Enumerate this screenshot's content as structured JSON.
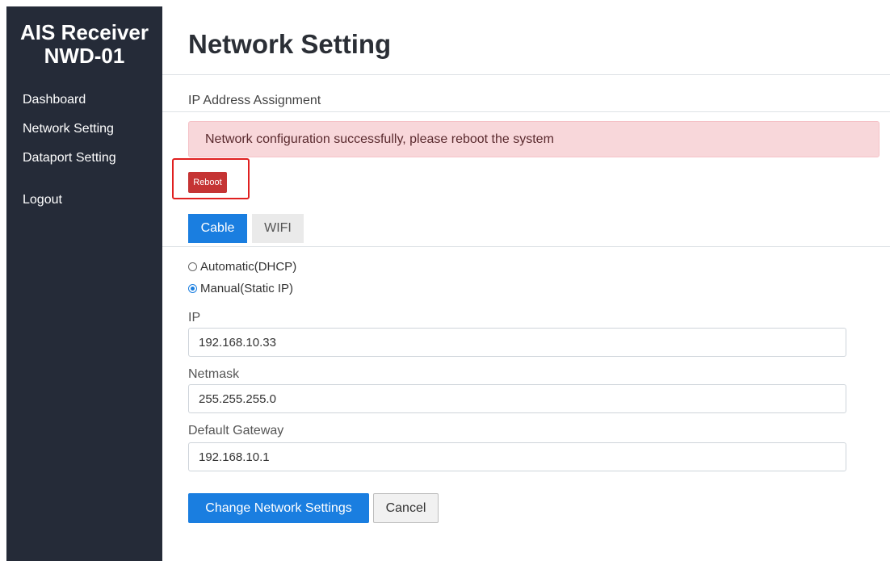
{
  "sidebar": {
    "brand_line1": "AIS Receiver",
    "brand_line2": "NWD-01",
    "items": [
      {
        "label": "Dashboard"
      },
      {
        "label": "Network Setting"
      },
      {
        "label": "Dataport Setting"
      },
      {
        "label": "Logout"
      }
    ]
  },
  "main": {
    "title": "Network Setting",
    "section_label": "IP Address Assignment",
    "alert_text": "Network configuration successfully, please reboot the system",
    "reboot_label": "Reboot",
    "tabs": [
      {
        "label": "Cable",
        "active": true
      },
      {
        "label": "WIFI",
        "active": false
      }
    ],
    "assignment_options": [
      {
        "label": "Automatic(DHCP)",
        "checked": false
      },
      {
        "label": "Manual(Static IP)",
        "checked": true
      }
    ],
    "fields": {
      "ip": {
        "label": "IP",
        "value": "192.168.10.33"
      },
      "netmask": {
        "label": "Netmask",
        "value": "255.255.255.0"
      },
      "gateway": {
        "label": "Default Gateway",
        "value": "192.168.10.1"
      }
    },
    "submit_label": "Change Network Settings",
    "cancel_label": "Cancel"
  },
  "colors": {
    "sidebar_bg": "#252b38",
    "primary": "#1a7ee0",
    "danger": "#c53434",
    "alert_bg": "#f8d7da",
    "highlight": "#e02020"
  }
}
